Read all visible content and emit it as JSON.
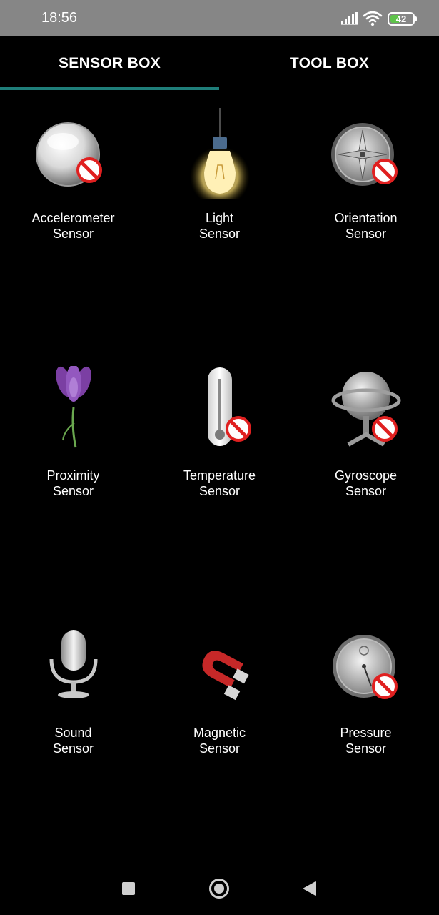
{
  "status_bar": {
    "time": "18:56",
    "battery": "42",
    "icons": [
      "signal-icon",
      "wifi-icon",
      "battery-icon"
    ]
  },
  "tabs": [
    {
      "label": "SENSOR BOX",
      "selected": true
    },
    {
      "label": "TOOL BOX",
      "selected": false
    }
  ],
  "sensors": [
    {
      "line1": "Accelerometer",
      "line2": "Sensor",
      "icon": "sphere-icon",
      "unavailable": true
    },
    {
      "line1": "Light",
      "line2": "Sensor",
      "icon": "lightbulb-icon",
      "unavailable": false
    },
    {
      "line1": "Orientation",
      "line2": "Sensor",
      "icon": "compass-icon",
      "unavailable": true
    },
    {
      "line1": "Proximity",
      "line2": "Sensor",
      "icon": "flower-icon",
      "unavailable": false
    },
    {
      "line1": "Temperature",
      "line2": "Sensor",
      "icon": "thermometer-icon",
      "unavailable": true
    },
    {
      "line1": "Gyroscope",
      "line2": "Sensor",
      "icon": "gyroscope-icon",
      "unavailable": true
    },
    {
      "line1": "Sound",
      "line2": "Sensor",
      "icon": "microphone-icon",
      "unavailable": false
    },
    {
      "line1": "Magnetic",
      "line2": "Sensor",
      "icon": "magnet-icon",
      "unavailable": false
    },
    {
      "line1": "Pressure",
      "line2": "Sensor",
      "icon": "barometer-icon",
      "unavailable": true
    }
  ],
  "nav_bar": {
    "icons": [
      "recent-apps-icon",
      "home-icon",
      "back-icon"
    ]
  }
}
